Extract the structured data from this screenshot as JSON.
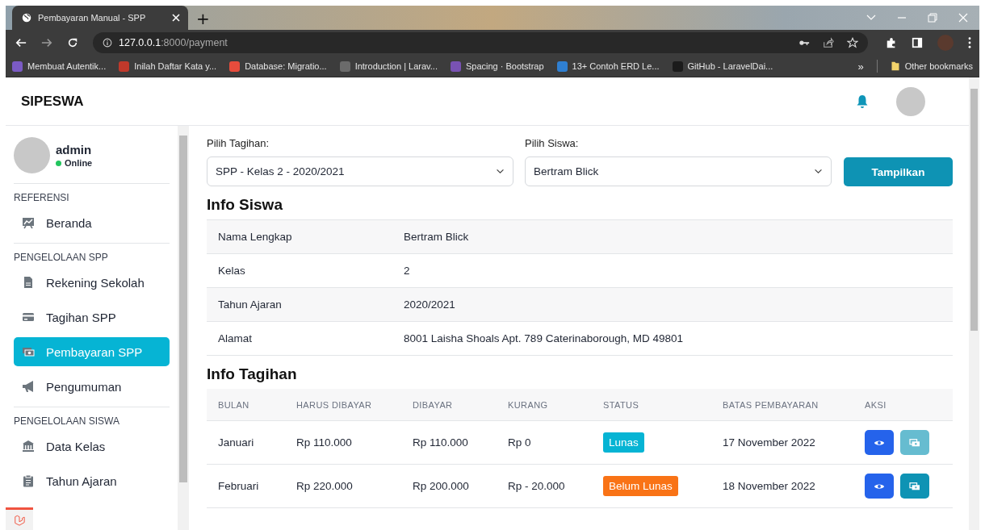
{
  "browser": {
    "tab_title": "Pembayaran Manual - SPP",
    "new_tab": "+",
    "url_host": "127.0.0.1",
    "url_path": ":8000/payment",
    "bookmarks": [
      {
        "label": "Membuat Autentik...",
        "color": "#7b5bc4"
      },
      {
        "label": "Inilah Daftar Kata y...",
        "color": "#c0392b"
      },
      {
        "label": "Database: Migratio...",
        "color": "#e74c3c"
      },
      {
        "label": "Introduction | Larav...",
        "color": "#6b6b6b"
      },
      {
        "label": "Spacing · Bootstrap",
        "color": "#7952b3"
      },
      {
        "label": "13+ Contoh ERD Le...",
        "color": "#2f7fd1"
      },
      {
        "label": "GitHub - LaravelDai...",
        "color": "#1b1b1b"
      }
    ],
    "overflow": "»",
    "other_bookmarks": "Other bookmarks"
  },
  "app": {
    "brand": "SIPESWA"
  },
  "sidebar": {
    "user": {
      "name": "admin",
      "status": "Online"
    },
    "sections": [
      {
        "heading": "REFERENSI",
        "items": [
          {
            "label": "Beranda",
            "kind": "board",
            "selected": false
          }
        ]
      },
      {
        "heading": "PENGELOLAAN SPP",
        "items": [
          {
            "label": "Rekening Sekolah",
            "kind": "file",
            "selected": false
          },
          {
            "label": "Tagihan SPP",
            "kind": "card",
            "selected": false
          },
          {
            "label": "Pembayaran SPP",
            "kind": "money",
            "selected": true
          },
          {
            "label": "Pengumuman",
            "kind": "megaphone",
            "selected": false
          }
        ]
      },
      {
        "heading": "PENGELOLAAN SISWA",
        "items": [
          {
            "label": "Data Kelas",
            "kind": "bank",
            "selected": false
          },
          {
            "label": "Tahun Ajaran",
            "kind": "clipboard",
            "selected": false
          }
        ]
      }
    ]
  },
  "filter": {
    "fields": [
      {
        "label": "Pilih Tagihan:",
        "value": "SPP - Kelas 2 - 2020/2021"
      },
      {
        "label": "Pilih Siswa:",
        "value": "Bertram Blick"
      }
    ],
    "button": "Tampilkan"
  },
  "info_siswa": {
    "title": "Info Siswa",
    "rows": [
      {
        "label": "Nama Lengkap",
        "value": "Bertram Blick"
      },
      {
        "label": "Kelas",
        "value": "2"
      },
      {
        "label": "Tahun Ajaran",
        "value": "2020/2021"
      },
      {
        "label": "Alamat",
        "value": "8001 Laisha Shoals Apt. 789 Caterinaborough, MD 49801"
      }
    ]
  },
  "info_tagihan": {
    "title": "Info Tagihan",
    "columns": [
      "BULAN",
      "HARUS DIBAYAR",
      "DIBAYAR",
      "KURANG",
      "STATUS",
      "BATAS PEMBAYARAN",
      "AKSI"
    ],
    "rows": [
      {
        "cells": [
          "Januari",
          "Rp 110.000",
          "Rp 110.000",
          "Rp 0"
        ],
        "status": {
          "label": "Lunas",
          "kind": "paid"
        },
        "due": "17 November 2022",
        "pay_disabled": true
      },
      {
        "cells": [
          "Februari",
          "Rp 220.000",
          "Rp 200.000",
          "Rp - 20.000"
        ],
        "status": {
          "label": "Belum Lunas",
          "kind": "unpaid"
        },
        "due": "18 November 2022",
        "pay_disabled": false
      }
    ]
  }
}
